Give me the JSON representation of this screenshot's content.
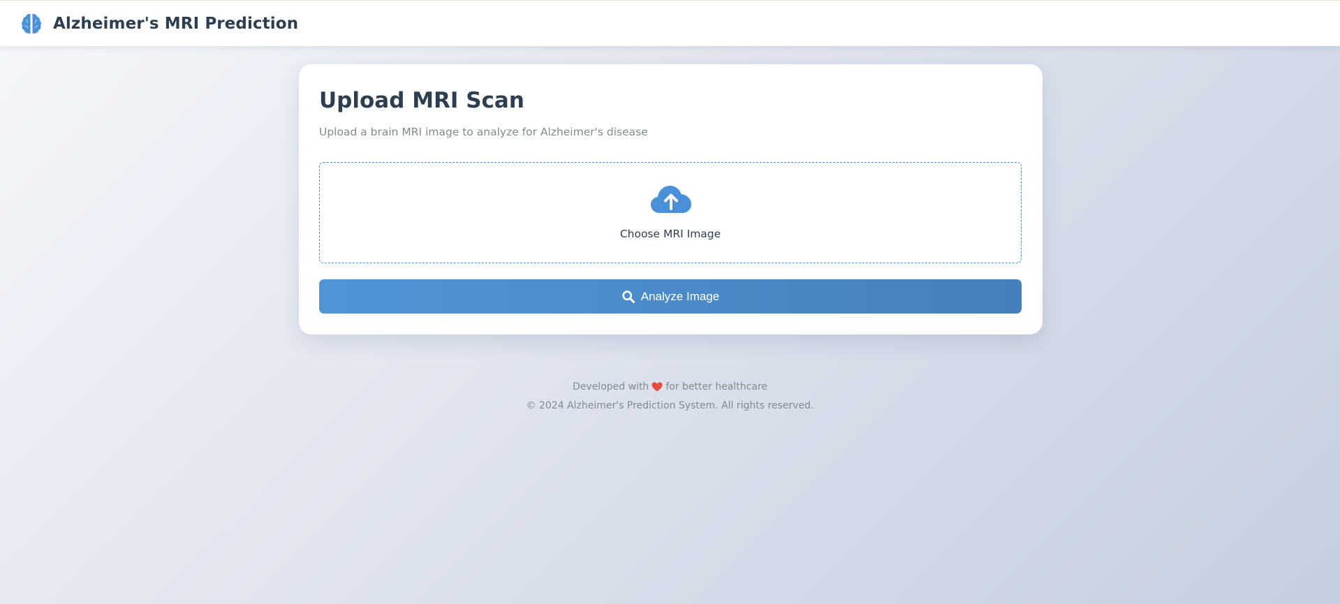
{
  "header": {
    "title": "Alzheimer's MRI Prediction",
    "logo_icon": "brain-icon"
  },
  "upload_card": {
    "title": "Upload MRI Scan",
    "subtitle": "Upload a brain MRI image to analyze for Alzheimer's disease",
    "dropzone": {
      "icon": "cloud-upload-icon",
      "label": "Choose MRI Image"
    },
    "analyze_button": {
      "icon": "search-icon",
      "label": "Analyze Image"
    }
  },
  "footer": {
    "line1_prefix": "Developed with",
    "line1_icon": "heart-icon",
    "line1_suffix": "for better healthcare",
    "copyright": "© 2024 Alzheimer's Prediction System. All rights reserved."
  },
  "colors": {
    "accent": "#4a90d9",
    "text_dark": "#2c3e50",
    "text_muted": "#7f8c8d",
    "heart": "#e74c3c"
  }
}
